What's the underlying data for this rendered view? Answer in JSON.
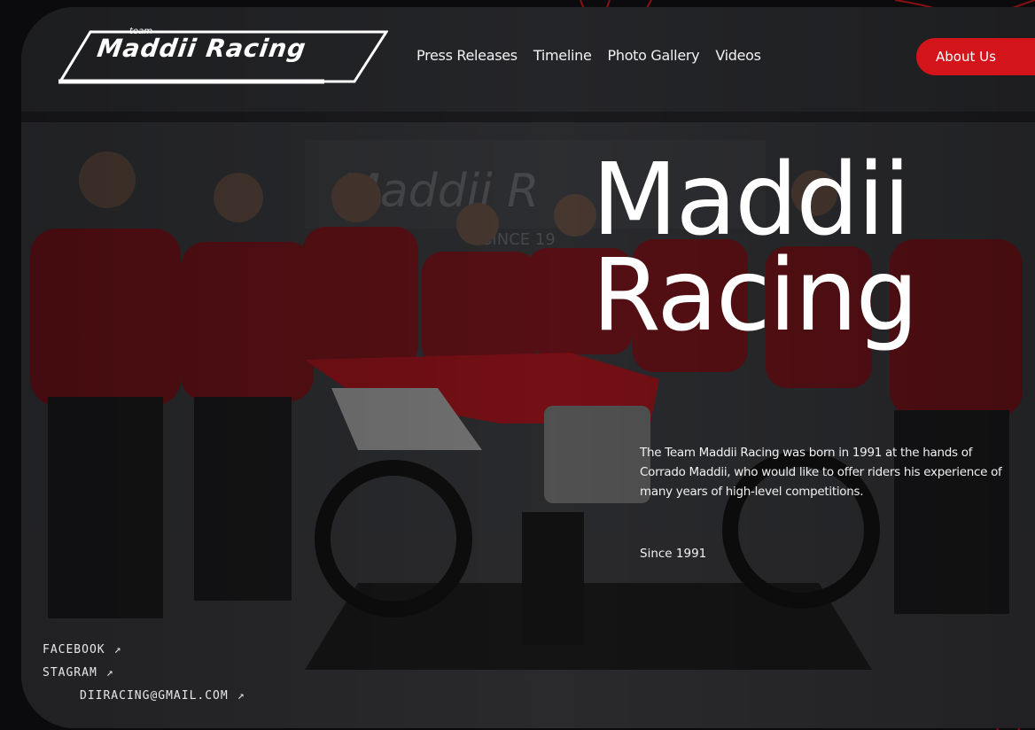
{
  "brand": {
    "logo_small": "team",
    "logo_main": "Maddii Racing"
  },
  "nav": {
    "items": [
      "Press Releases",
      "Timeline",
      "Photo Gallery",
      "Videos"
    ],
    "cta_label": "About Us"
  },
  "hero": {
    "title_line1": "Maddii",
    "title_line2": "Racing",
    "description": "The Team Maddii Racing was born in 1991 at the hands of Corrado Maddii, who would like to offer riders his experience of many years of high-level competitions.",
    "since": "Since 1991"
  },
  "social": {
    "facebook": "FACEBOOK",
    "instagram": "STAGRAM",
    "email": "DIIRACING@GMAIL.COM",
    "arrow_icon": "↗"
  },
  "colors": {
    "accent": "#d3141b",
    "background": "#0b0b0d",
    "text": "#ffffff"
  }
}
